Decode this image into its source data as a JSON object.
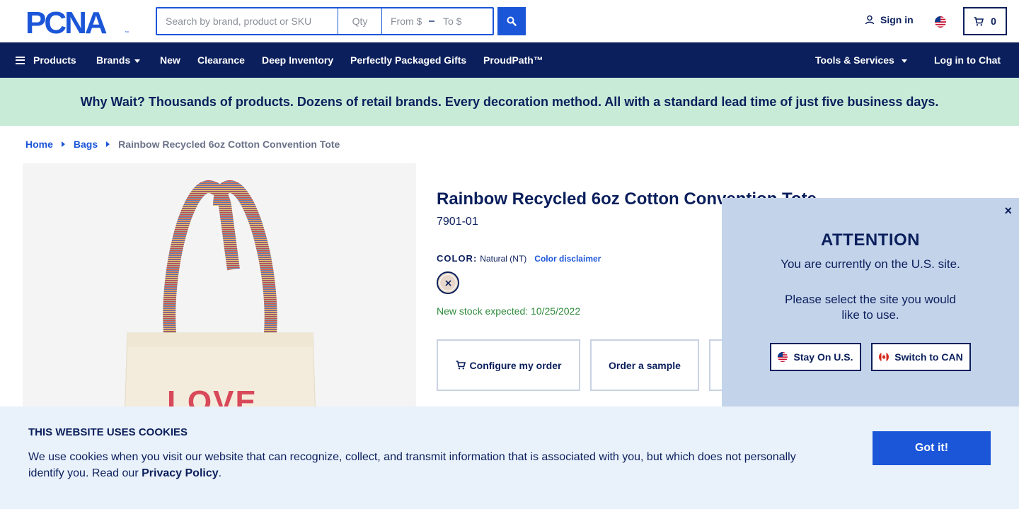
{
  "header": {
    "logo_text": "PCNA",
    "search": {
      "placeholder": "Search by brand, product or SKU",
      "qty_placeholder": "Qty",
      "from_placeholder": "From $",
      "to_placeholder": "To $"
    },
    "signin_label": "Sign in",
    "cart_count": "0"
  },
  "nav": {
    "products": "Products",
    "brands": "Brands",
    "new": "New",
    "clearance": "Clearance",
    "deep_inventory": "Deep Inventory",
    "gifts": "Perfectly Packaged Gifts",
    "proudpath": "ProudPath™",
    "tools": "Tools & Services",
    "chat": "Log in to Chat"
  },
  "promo": "Why Wait? Thousands of products. Dozens of retail brands. Every decoration method. All with a standard lead time of just five business days.",
  "breadcrumb": {
    "home": "Home",
    "bags": "Bags",
    "current": "Rainbow Recycled 6oz Cotton Convention Tote"
  },
  "product": {
    "title": "Rainbow Recycled 6oz Cotton Convention Tote",
    "sku": "7901-01",
    "color_label": "COLOR:",
    "color_value": "Natural (NT)",
    "color_disclaimer": "Color disclaimer",
    "stock": "New stock expected: 10/25/2022",
    "configure_label": "Configure my order",
    "sample_label": "Order a sample",
    "image_text": "LOVE"
  },
  "attention": {
    "title": "ATTENTION",
    "line1": "You are currently on the U.S. site.",
    "line2": "Please select the site you would like to use.",
    "stay_label": "Stay On U.S.",
    "switch_label": "Switch to CAN",
    "close": "×"
  },
  "cookie": {
    "title": "THIS WEBSITE USES COOKIES",
    "text": "We use cookies when you visit our website that can recognize, collect, and transmit information that is associated with you, but which does not personally identify you. Read our",
    "policy_link": "Privacy Policy",
    "period": ".",
    "button": "Got it!"
  },
  "colors": {
    "navy": "#0b1f5c",
    "blue": "#1b56d8",
    "promo_bg": "#c8ebd8",
    "popup_bg": "#c3d3ea",
    "cookie_bg": "#e9f1fa",
    "stock_green": "#2d8a3a"
  }
}
